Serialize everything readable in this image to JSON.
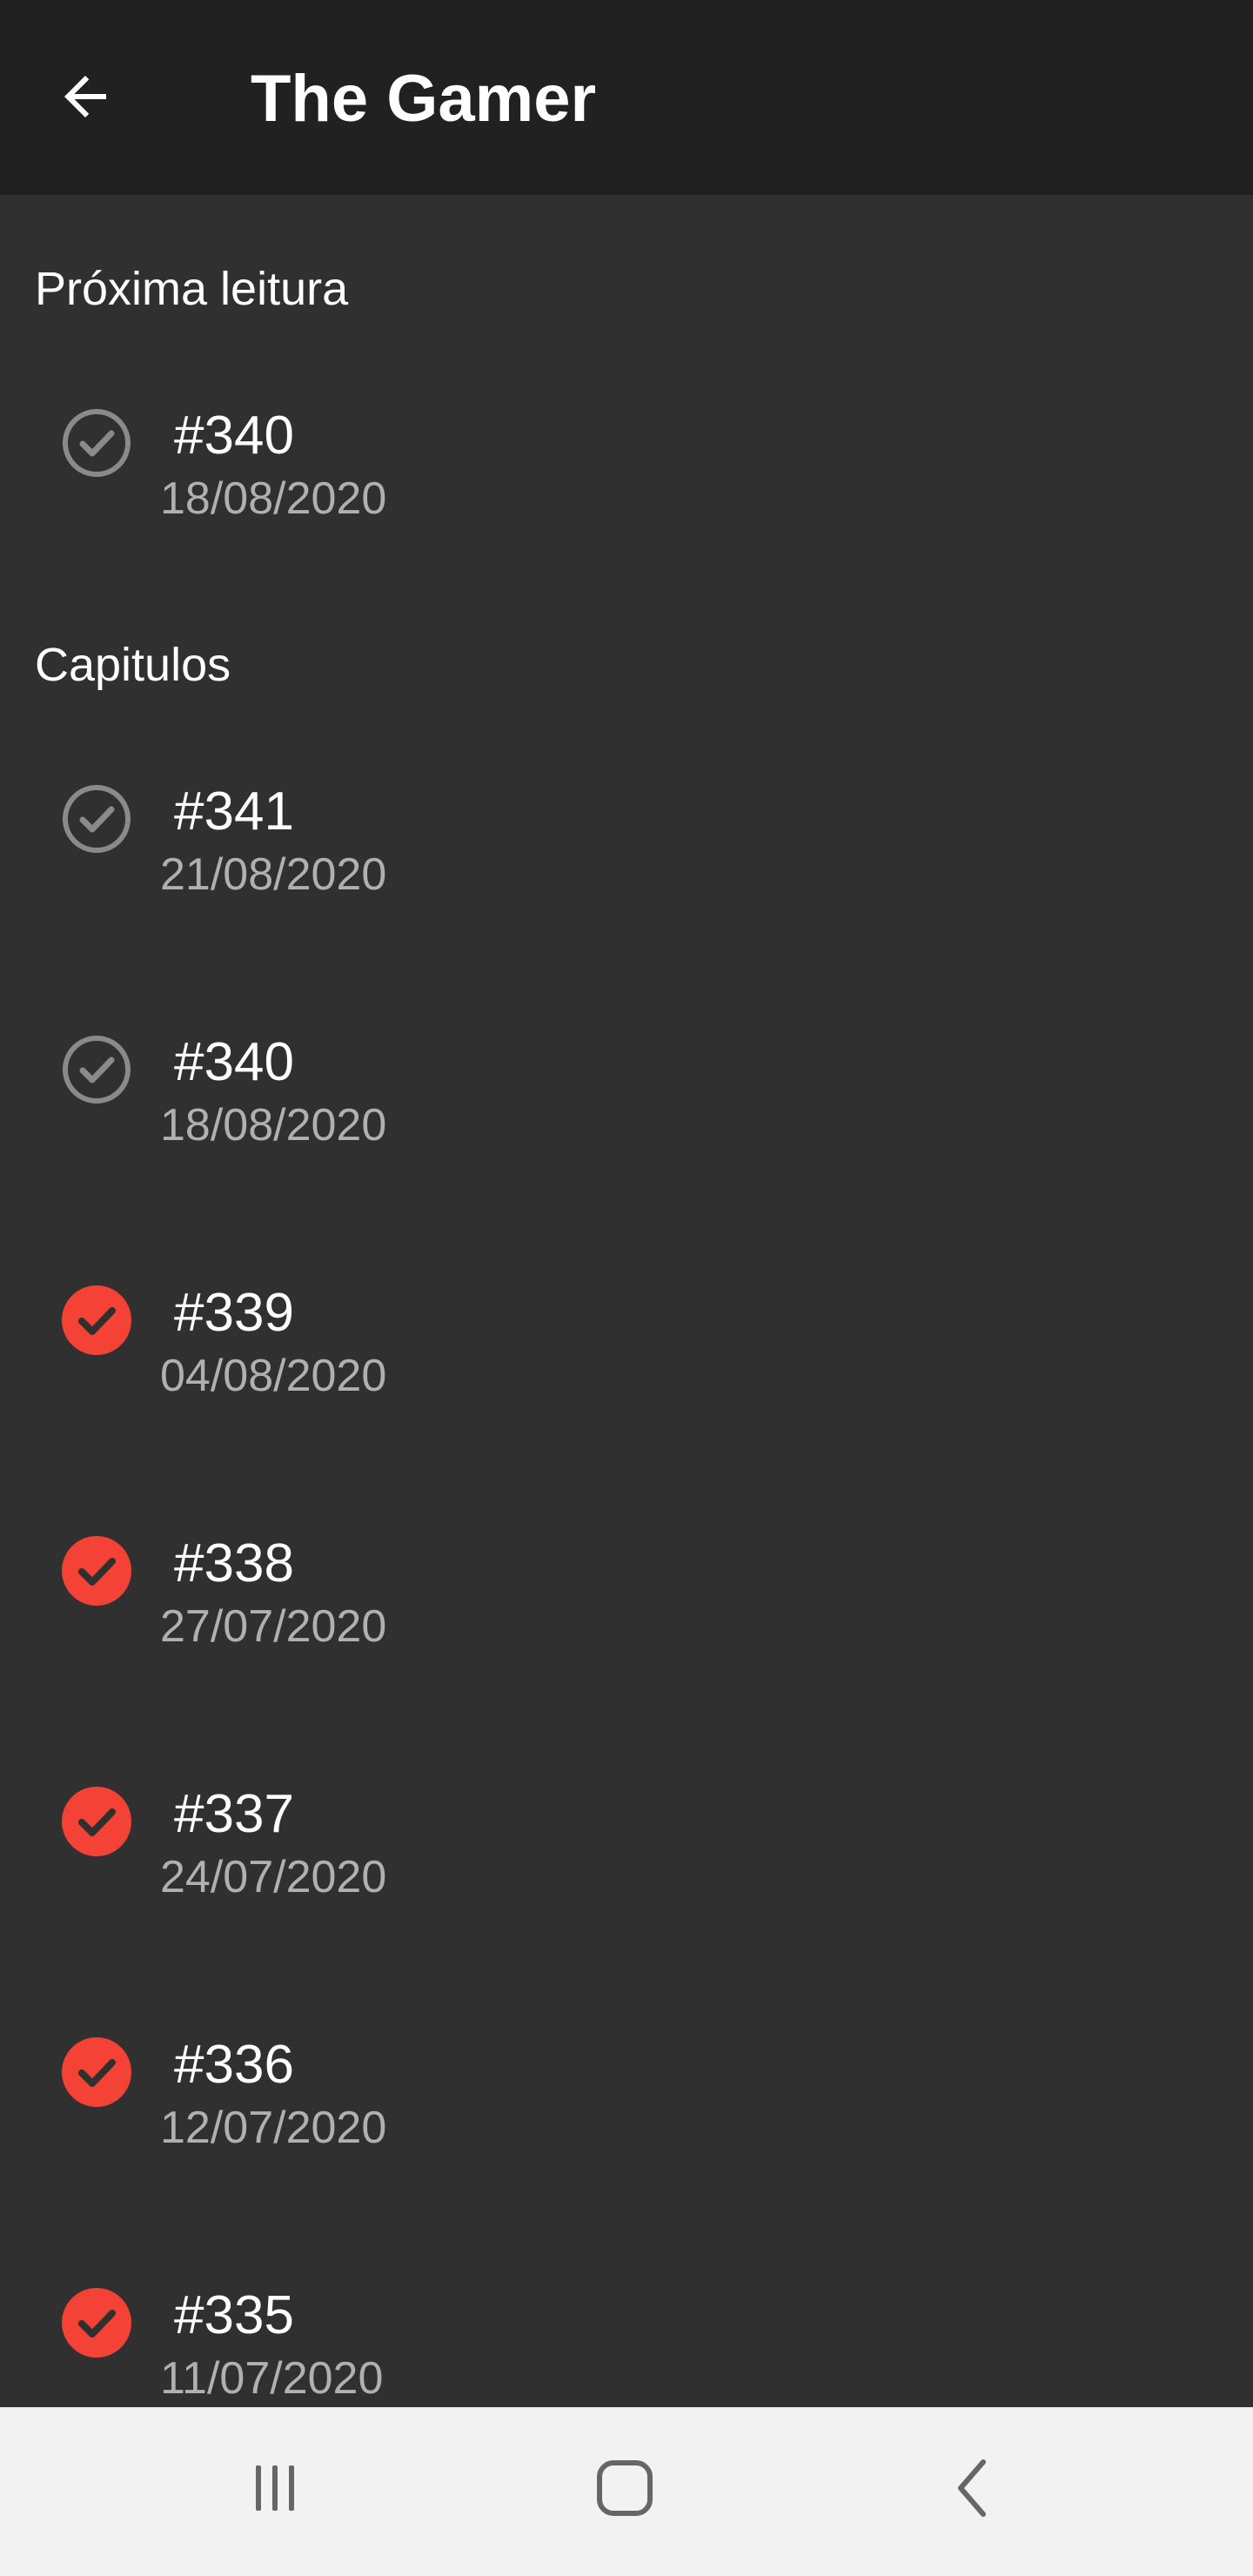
{
  "appbar": {
    "title": "The Gamer",
    "back_icon": "arrow-back-icon"
  },
  "next_read": {
    "section_label": "Próxima leitura",
    "item": {
      "number": "#340",
      "date": "18/08/2020",
      "read": false
    }
  },
  "chapters": {
    "section_label": "Capitulos",
    "items": [
      {
        "number": "#341",
        "date": "21/08/2020",
        "read": false
      },
      {
        "number": "#340",
        "date": "18/08/2020",
        "read": false
      },
      {
        "number": "#339",
        "date": "04/08/2020",
        "read": true
      },
      {
        "number": "#338",
        "date": "27/07/2020",
        "read": true
      },
      {
        "number": "#337",
        "date": "24/07/2020",
        "read": true
      },
      {
        "number": "#336",
        "date": "12/07/2020",
        "read": true
      },
      {
        "number": "#335",
        "date": "11/07/2020",
        "read": true
      }
    ]
  },
  "colors": {
    "appbar": "#212121",
    "background": "#303030",
    "read_check": "#f44336",
    "unread_check": "#8a8a8a"
  },
  "navbar": {
    "recents_icon": "recents-icon",
    "home_icon": "home-icon",
    "back_icon": "nav-back-icon"
  }
}
